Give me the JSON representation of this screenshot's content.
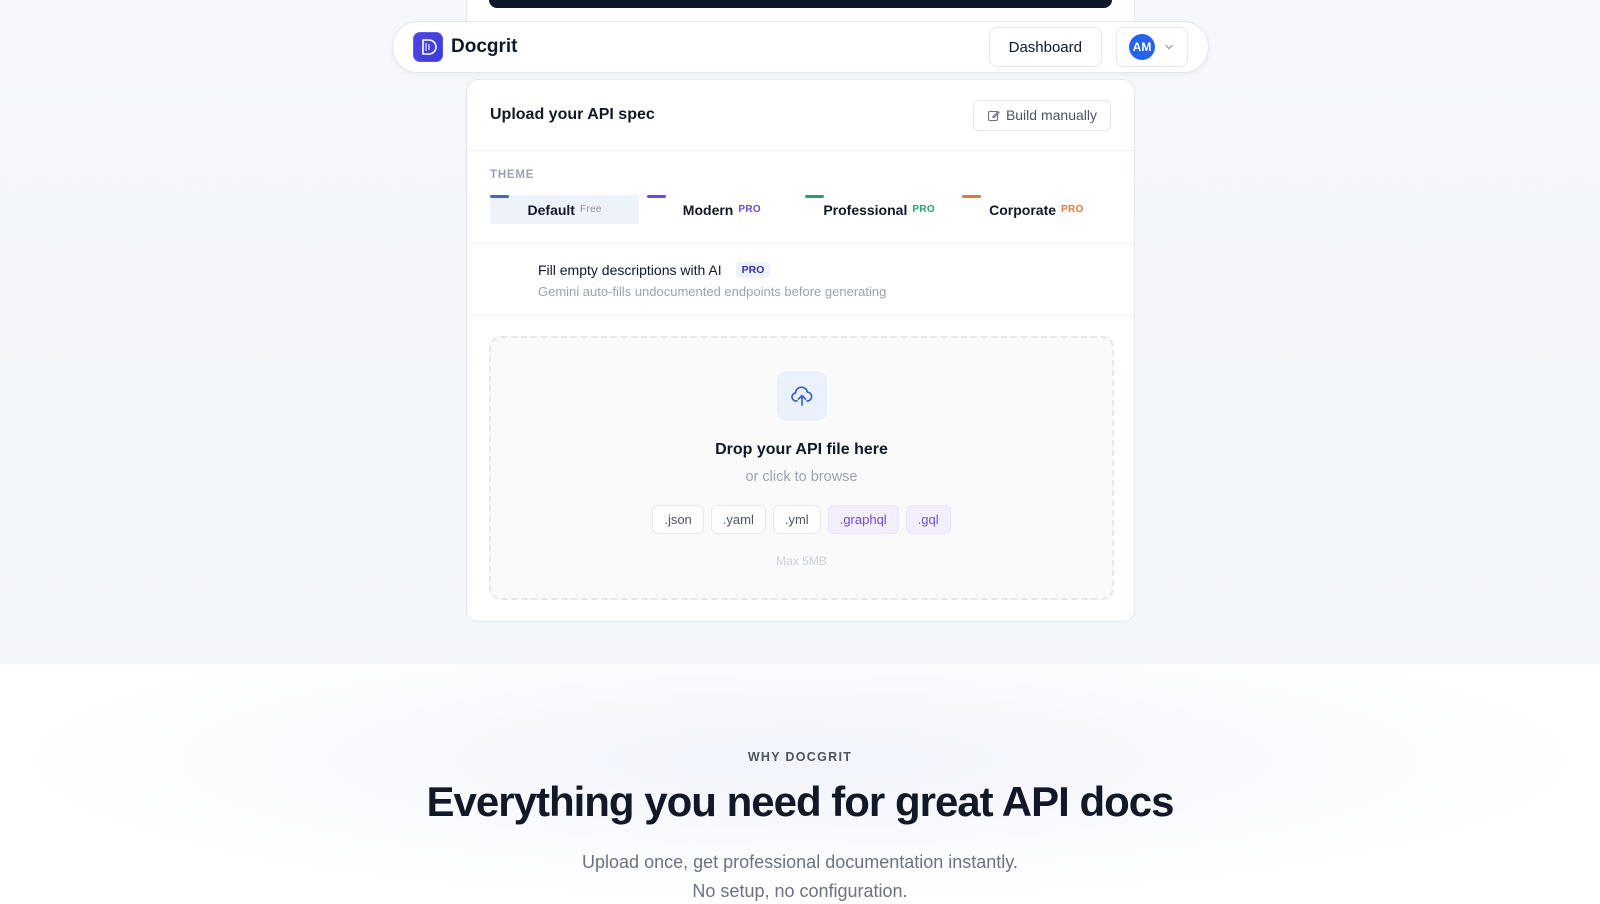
{
  "nav": {
    "brand": "Docgrit",
    "dashboard_label": "Dashboard",
    "avatar_initials": "AM",
    "logo_icon": "docgrit-logo-icon",
    "dropdown_icon": "chevron-down-icon"
  },
  "upload": {
    "title": "Upload your API spec",
    "build_manually_label": "Build manually",
    "build_icon": "edit-icon",
    "theme_label": "THEME",
    "themes": [
      {
        "name": "Default",
        "tag": "Free",
        "color": "#4a63c9",
        "selected": true
      },
      {
        "name": "Modern",
        "tag": "PRO",
        "color": "#6d4ad6",
        "selected": false
      },
      {
        "name": "Professional",
        "tag": "PRO",
        "color": "#2f9e6e",
        "selected": false
      },
      {
        "name": "Corporate",
        "tag": "PRO",
        "color": "#e07a3c",
        "selected": false
      }
    ],
    "ai": {
      "title": "Fill empty descriptions with AI",
      "badge": "PRO",
      "subtitle": "Gemini auto-fills undocumented endpoints before generating"
    },
    "dropzone": {
      "icon": "cloud-upload-icon",
      "title": "Drop your API file here",
      "subtitle": "or click to browse",
      "extensions": [
        ".json",
        ".yaml",
        ".yml",
        ".graphql",
        ".gql"
      ],
      "max_size": "Max 5MB"
    }
  },
  "features": {
    "eyebrow": "WHY DOCGRIT",
    "headline": "Everything you need for great API docs",
    "subline_1": "Upload once, get professional documentation instantly.",
    "subline_2": "No setup, no configuration."
  }
}
